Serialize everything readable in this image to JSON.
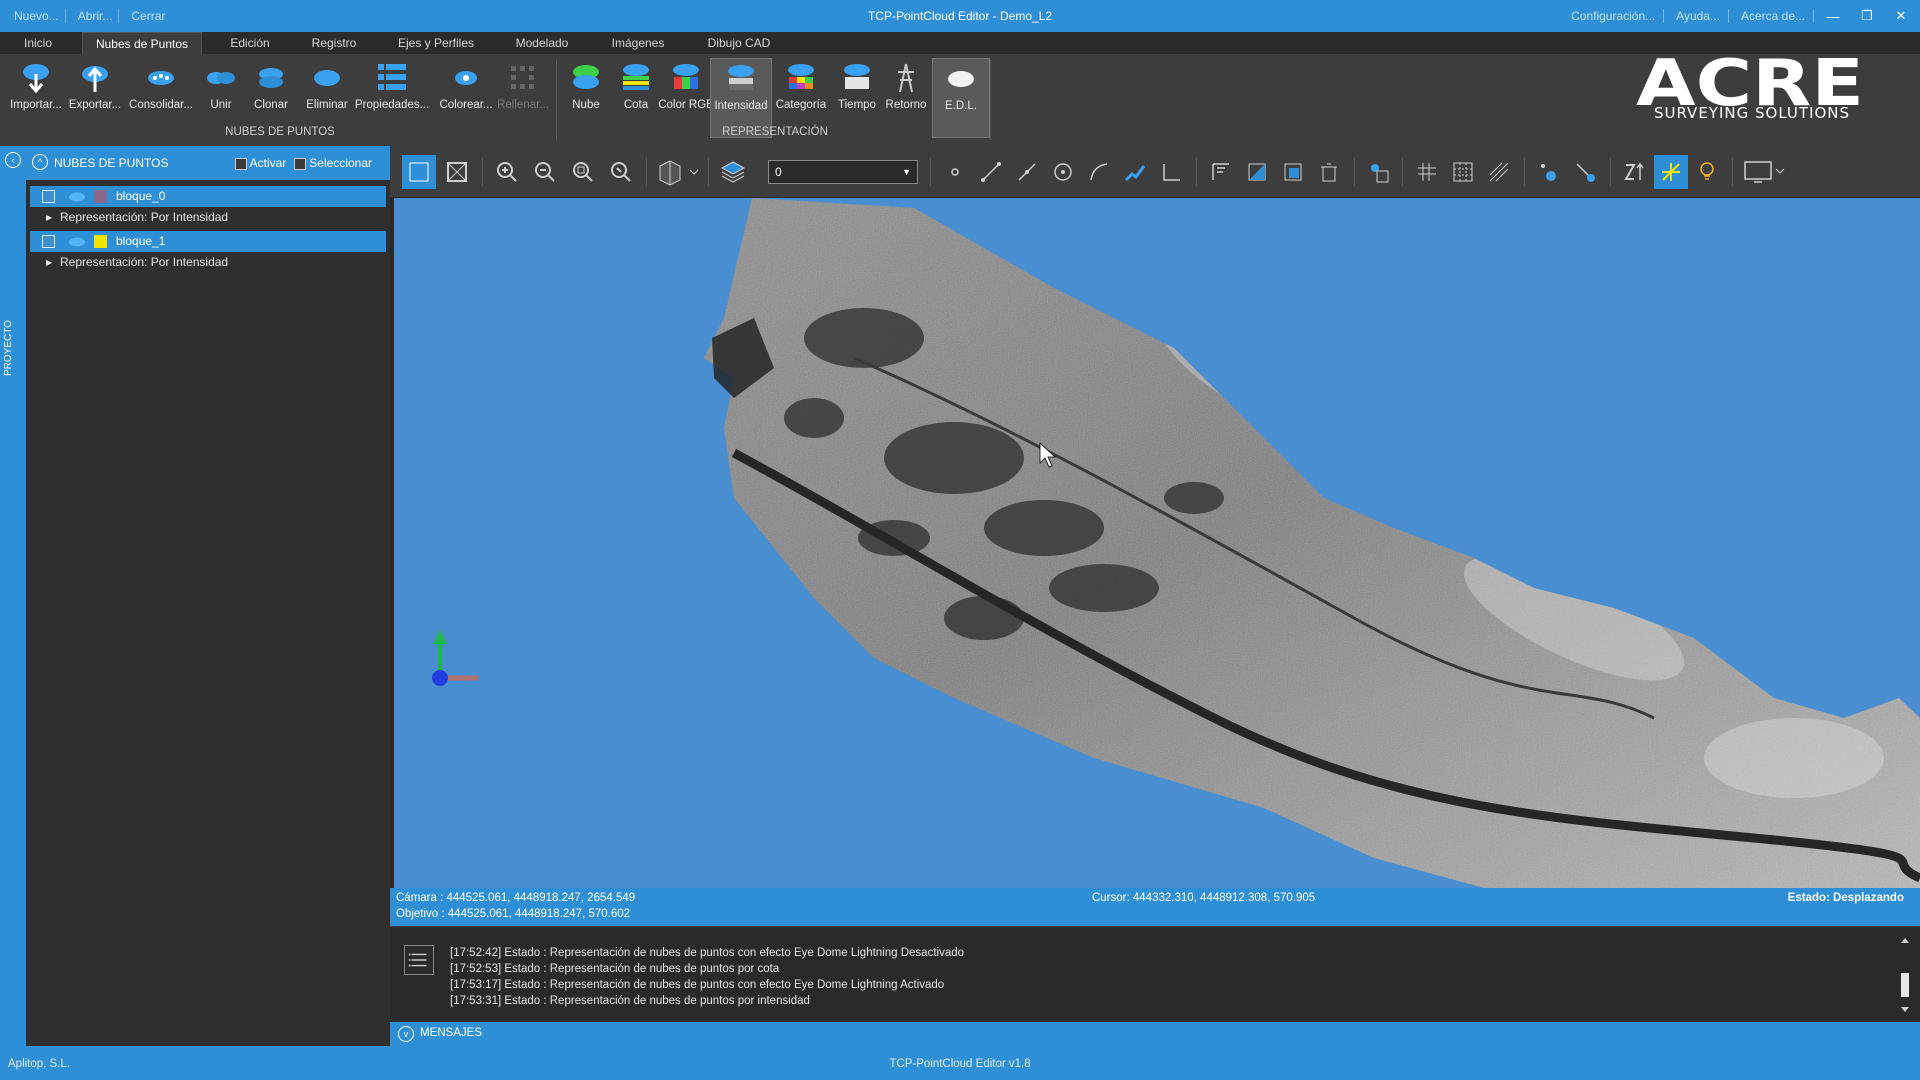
{
  "titlebar": {
    "left_links": [
      "Nuevo...",
      "Abrir...",
      "Cerrar"
    ],
    "title": "TCP-PointCloud Editor - Demo_L2",
    "right_links": [
      "Configuración...",
      "Ayuda...",
      "Acerca de..."
    ],
    "minimize": "—",
    "restore": "❐",
    "close": "✕"
  },
  "ribbon": {
    "tabs": [
      "Inicio",
      "Nubes de Puntos",
      "Edición",
      "Registro",
      "Ejes y Perfiles",
      "Modelado",
      "Imágenes",
      "Dibujo CAD"
    ],
    "active_tab": "Nubes de Puntos",
    "group1": {
      "label": "NUBES DE PUNTOS",
      "buttons": [
        "Importar...",
        "Exportar...",
        "Consolidar...",
        "Unir",
        "Clonar",
        "Eliminar",
        "Propiedades...",
        "Colorear...",
        "Rellenar..."
      ]
    },
    "group2": {
      "label": "REPRESENTACIÓN",
      "buttons": [
        "Nube",
        "Cota",
        "Color RGB",
        "Intensidad",
        "Categoría",
        "Tiempo",
        "Retorno",
        "E.D.L."
      ]
    }
  },
  "logo": {
    "text": "ACRE",
    "subtitle": "SURVEYING SOLUTIONS"
  },
  "sidebar": {
    "vertical_label": "PROYECTO"
  },
  "panel": {
    "title": "NUBES DE PUNTOS",
    "activate_label": "Activar",
    "select_label": "Seleccionar",
    "items": [
      {
        "name": "bloque_0",
        "representation": "Representación: Por Intensidad",
        "color": "#8a6a8a"
      },
      {
        "name": "bloque_1",
        "representation": "Representación: Por Intensidad",
        "color": "#f2e600"
      }
    ]
  },
  "toolbar": {
    "layer_value": "0"
  },
  "coords": {
    "camera": "Cámara : 444525.061, 4448918.247, 2654.549",
    "target": "Objetivo : 444525.061, 4448918.247, 570.602",
    "cursor": "Cursor: 444332.310, 4448912.308, 570.905",
    "state": "Estado: Desplazando"
  },
  "messages": {
    "lines": [
      "[17:52:42] Estado : Representación de nubes de puntos con efecto Eye Dome Lightning Desactivado",
      "[17:52:53] Estado : Representación de nubes de puntos por cota",
      "[17:53:17] Estado : Representación de nubes de puntos con efecto Eye Dome Lightning Activado",
      "[17:53:31] Estado : Representación de nubes de puntos por intensidad"
    ],
    "footer_label": "MENSAJES"
  },
  "statusbar": {
    "company": "Aplitop, S.L.",
    "version": "TCP-PointCloud Editor v1.8"
  },
  "colors": {
    "accent": "#2f8fd6",
    "viewport_bg": "#4a8ed2",
    "ribbon_bg": "#3d3d3d"
  }
}
